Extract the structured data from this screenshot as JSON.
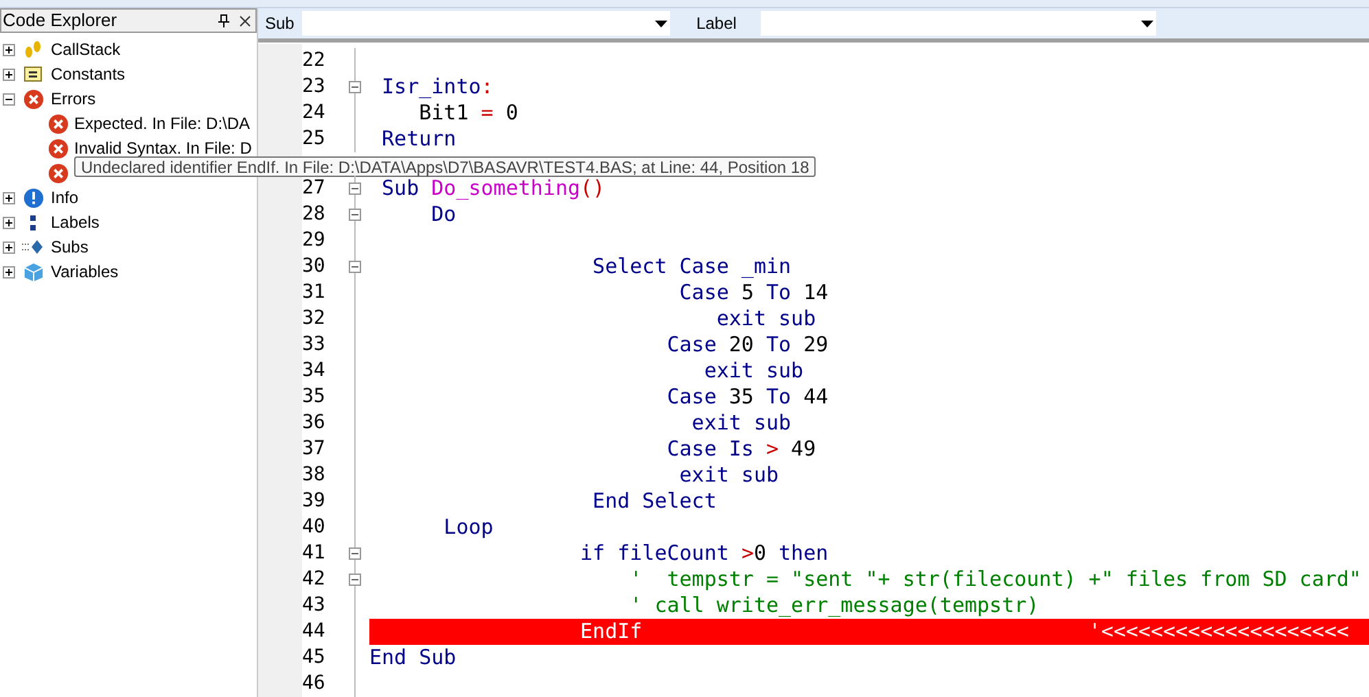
{
  "explorer": {
    "title": "Code Explorer",
    "items": [
      {
        "label": "CallStack",
        "kind": "callstack",
        "expanded": false
      },
      {
        "label": "Constants",
        "kind": "constants",
        "expanded": false
      },
      {
        "label": "Errors",
        "kind": "error",
        "expanded": true,
        "children": [
          {
            "label": "Expected. In File: D:\\DA",
            "kind": "error"
          },
          {
            "label": "Invalid Syntax. In File: D",
            "kind": "error"
          },
          {
            "kind": "error"
          }
        ]
      },
      {
        "label": "Info",
        "kind": "info",
        "expanded": false
      },
      {
        "label": "Labels",
        "kind": "labels",
        "expanded": false
      },
      {
        "label": "Subs",
        "kind": "subs",
        "expanded": false
      },
      {
        "label": "Variables",
        "kind": "variables",
        "expanded": false
      }
    ]
  },
  "toolbar": {
    "sub_label": "Sub",
    "label_label": "Label"
  },
  "editor": {
    "lines": [
      {
        "kind": "code",
        "number": "22"
      },
      {
        "kind": "code",
        "number": "23",
        "fold": true,
        "tokens": [
          {
            "text": " Isr_into",
            "kind": "keyword"
          },
          {
            "text": ":",
            "kind": "op"
          }
        ]
      },
      {
        "kind": "code",
        "number": "24",
        "tokens": [
          {
            "text": "    Bit1 ",
            "kind": "plain"
          },
          {
            "text": "=",
            "kind": "op"
          },
          {
            "text": " 0",
            "kind": "plain"
          }
        ]
      },
      {
        "kind": "code",
        "number": "25",
        "tokens": [
          {
            "text": " Return",
            "kind": "keyword"
          }
        ]
      },
      {
        "kind": "tooltip",
        "text": "Undeclared identifier EndIf. In File: D:\\DATA\\Apps\\D7\\BASAVR\\TEST4.BAS; at Line: 44, Position 18"
      },
      {
        "kind": "code",
        "number": "27",
        "fold": true,
        "tokens": [
          {
            "text": " Sub ",
            "kind": "keyword"
          },
          {
            "text": "Do_something",
            "kind": "func"
          },
          {
            "text": "()",
            "kind": "op"
          }
        ]
      },
      {
        "kind": "code",
        "number": "28",
        "fold": true,
        "tokens": [
          {
            "text": "     Do",
            "kind": "keyword"
          }
        ]
      },
      {
        "kind": "code",
        "number": "29"
      },
      {
        "kind": "code",
        "number": "30",
        "fold": true,
        "tokens": [
          {
            "text": "                  Select Case _min",
            "kind": "keyword"
          }
        ]
      },
      {
        "kind": "code",
        "number": "31",
        "tokens": [
          {
            "text": "                         Case ",
            "kind": "keyword"
          },
          {
            "text": "5",
            "kind": "plain"
          },
          {
            "text": " To ",
            "kind": "keyword"
          },
          {
            "text": "14",
            "kind": "plain"
          }
        ]
      },
      {
        "kind": "code",
        "number": "32",
        "tokens": [
          {
            "text": "                            exit sub",
            "kind": "keyword"
          }
        ]
      },
      {
        "kind": "code",
        "number": "33",
        "tokens": [
          {
            "text": "                        Case ",
            "kind": "keyword"
          },
          {
            "text": "20",
            "kind": "plain"
          },
          {
            "text": " To ",
            "kind": "keyword"
          },
          {
            "text": "29",
            "kind": "plain"
          }
        ]
      },
      {
        "kind": "code",
        "number": "34",
        "tokens": [
          {
            "text": "                           exit sub",
            "kind": "keyword"
          }
        ]
      },
      {
        "kind": "code",
        "number": "35",
        "tokens": [
          {
            "text": "                        Case ",
            "kind": "keyword"
          },
          {
            "text": "35",
            "kind": "plain"
          },
          {
            "text": " To ",
            "kind": "keyword"
          },
          {
            "text": "44",
            "kind": "plain"
          }
        ]
      },
      {
        "kind": "code",
        "number": "36",
        "tokens": [
          {
            "text": "                          exit sub",
            "kind": "keyword"
          }
        ]
      },
      {
        "kind": "code",
        "number": "37",
        "tokens": [
          {
            "text": "                        Case Is ",
            "kind": "keyword"
          },
          {
            "text": ">",
            "kind": "op"
          },
          {
            "text": " 49",
            "kind": "plain"
          }
        ]
      },
      {
        "kind": "code",
        "number": "38",
        "tokens": [
          {
            "text": "                         exit sub",
            "kind": "keyword"
          }
        ]
      },
      {
        "kind": "code",
        "number": "39",
        "tokens": [
          {
            "text": "                  End Select",
            "kind": "keyword"
          }
        ]
      },
      {
        "kind": "code",
        "number": "40",
        "tokens": [
          {
            "text": "      Loop",
            "kind": "keyword"
          }
        ]
      },
      {
        "kind": "code",
        "number": "41",
        "fold": true,
        "tokens": [
          {
            "text": "                 if fileCount ",
            "kind": "keyword"
          },
          {
            "text": ">",
            "kind": "op"
          },
          {
            "text": "0",
            "kind": "plain"
          },
          {
            "text": " then",
            "kind": "keyword"
          }
        ]
      },
      {
        "kind": "code",
        "number": "42",
        "fold": true,
        "tokens": [
          {
            "text": "                     '  tempstr = \"sent \"+ str(filecount) +\" files from SD card\"",
            "kind": "comment"
          }
        ]
      },
      {
        "kind": "code",
        "number": "43",
        "tokens": [
          {
            "text": "                     ' call write_err_message(tempstr)",
            "kind": "comment"
          }
        ]
      },
      {
        "kind": "code",
        "number": "44",
        "error": true,
        "tokens": [
          {
            "text": "                 EndIf",
            "kind": "plain"
          },
          {
            "text": "                                    '<<<<<<<<<<<<<<<<<<<<",
            "kind": "comment"
          }
        ]
      },
      {
        "kind": "code",
        "number": "45",
        "tokens": [
          {
            "text": "End Sub",
            "kind": "keyword"
          }
        ]
      },
      {
        "kind": "code",
        "number": "46"
      }
    ]
  }
}
